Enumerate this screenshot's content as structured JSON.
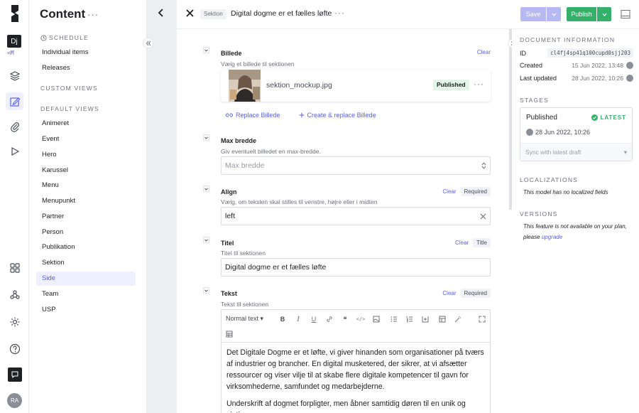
{
  "rail": {
    "project_badge": "Dj",
    "project_sub": "<M",
    "user_initials": "RA"
  },
  "nav": {
    "title": "Content",
    "schedule_label": "SCHEDULE",
    "schedule_items": [
      "Individual items",
      "Releases"
    ],
    "custom_views_label": "CUSTOM VIEWS",
    "default_views_label": "DEFAULT VIEWS",
    "default_items": [
      "Animeret",
      "Event",
      "Hero",
      "Karussel",
      "Menu",
      "Menupunkt",
      "Partner",
      "Person",
      "Publikation",
      "Sektion",
      "Side",
      "Team",
      "USP"
    ],
    "active_item": "Side"
  },
  "topbar": {
    "model_chip": "Sektion",
    "entry_title": "Digital dogme er et fælles løfte",
    "save_label": "Save",
    "publish_label": "Publish"
  },
  "fields": {
    "billede": {
      "label": "Billede",
      "hint": "Vælg et billede til sektionen",
      "clear": "Clear",
      "file_name": "sektion_mockup.jpg",
      "status": "Published",
      "replace_label": "Replace Billede",
      "create_replace_label": "Create & replace Billede"
    },
    "max_bredde": {
      "label": "Max bredde",
      "hint": "Giv eventuelt billedet en max-bredde.",
      "placeholder": "Max bredde"
    },
    "align": {
      "label": "Align",
      "hint": "Vælg, om teksten skal stilles til venstre, højre eller i midten",
      "clear": "Clear",
      "tag": "Required",
      "value": "left"
    },
    "titel": {
      "label": "Titel",
      "hint": "Titel til sektionen",
      "clear": "Clear",
      "tag": "Title",
      "value": "Digital dogme er et fælles løfte"
    },
    "tekst": {
      "label": "Tekst",
      "hint": "Tekst til sektionen",
      "clear": "Clear",
      "tag": "Required",
      "style_select": "Normal text",
      "paragraph1": "Det Digitale Dogme er et løfte, vi giver hinanden som organisationer på tværs af industrier og brancher. En digital musketered, der sikrer, at vi afsætter ressourcer og viser vilje til at skabe flere digitale kompetencer til gavn for virksomhederne, samfundet og medarbejderne.",
      "paragraph2": "Underskrift af dogmet forpligter, men åbner samtidig døren til en unik og vigtig"
    }
  },
  "sidebar": {
    "doc_info_label": "DOCUMENT INFORMATION",
    "id_label": "ID",
    "id_value": "cl4fj4sp41q100cupd0sjj203",
    "created_label": "Created",
    "created_value": "15 Jun 2022, 13:48",
    "updated_label": "Last updated",
    "updated_value": "28 Jun 2022, 10:26",
    "stages_label": "STAGES",
    "stage_name": "Published",
    "stage_badge": "LATEST",
    "stage_date": "28 Jun 2022, 10:26",
    "sync_label": "Sync with latest draft",
    "localizations_label": "LOCALIZATIONS",
    "localizations_note": "This model has no localized fields",
    "versions_label": "VERSIONS",
    "versions_note": "This feature is not available on your plan, please",
    "versions_link": "upgrade"
  },
  "colors": {
    "accent": "#5b61e8",
    "publish": "#34b06b",
    "save_disabled": "#b6b9f3"
  }
}
